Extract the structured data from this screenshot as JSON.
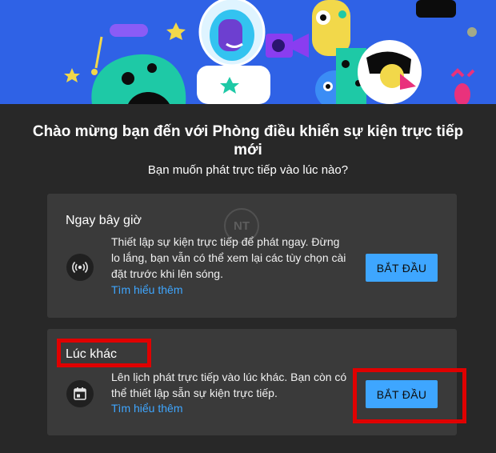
{
  "dialog": {
    "title": "Chào mừng bạn đến với Phòng điều khiển sự kiện trực tiếp mới",
    "subtitle": "Bạn muốn phát trực tiếp vào lúc nào?"
  },
  "options": [
    {
      "title": "Ngay bây giờ",
      "icon": "live-broadcast-icon",
      "description": "Thiết lập sự kiện trực tiếp để phát ngay. Đừng lo lắng, bạn vẫn có thể xem lại các tùy chọn cài đặt trước khi lên sóng.",
      "link": "Tìm hiểu thêm",
      "button": "BẮT ĐẦU"
    },
    {
      "title": "Lúc khác",
      "icon": "calendar-icon",
      "description": "Lên lịch phát trực tiếp vào lúc khác. Bạn còn có thể thiết lập sẵn sự kiện trực tiếp.",
      "link": "Tìm hiểu thêm",
      "button": "BẮT ĐẦU"
    }
  ],
  "watermark": "NT",
  "colors": {
    "banner": "#2f62e6",
    "background": "#282828",
    "card": "#3a3a3a",
    "accent": "#3ea6ff",
    "highlight": "#e00000"
  }
}
